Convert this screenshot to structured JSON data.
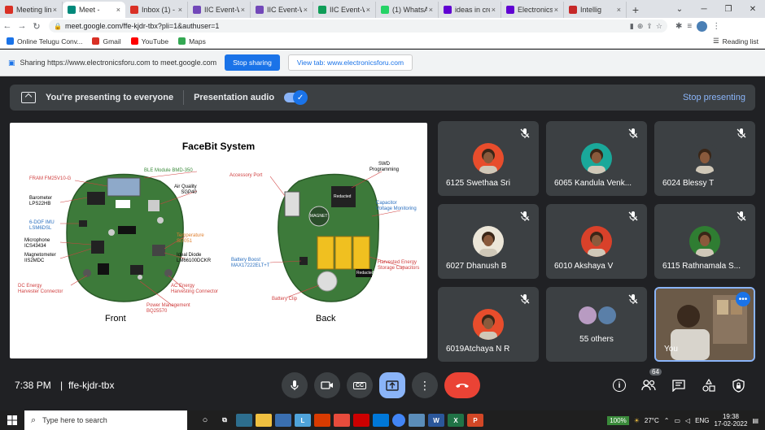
{
  "browser": {
    "tabs": [
      {
        "label": "Meeting lin",
        "icon": "gmail-icon",
        "color": "#d93025"
      },
      {
        "label": "Meet -",
        "icon": "meet-icon",
        "color": "#00897b",
        "active": true
      },
      {
        "label": "Inbox (1) -",
        "icon": "gmail-icon",
        "color": "#d93025"
      },
      {
        "label": "IIC Event-W",
        "icon": "forms-icon",
        "color": "#7248b9"
      },
      {
        "label": "IIC Event-W",
        "icon": "forms-icon",
        "color": "#7248b9"
      },
      {
        "label": "IIC Event-W",
        "icon": "sheets-icon",
        "color": "#0f9d58"
      },
      {
        "label": "(1) WhatsA",
        "icon": "whatsapp-icon",
        "color": "#25d366"
      },
      {
        "label": "ideas in cre",
        "icon": "yahoo-icon",
        "color": "#6001d2"
      },
      {
        "label": "Electronics",
        "icon": "yahoo-icon",
        "color": "#6001d2"
      },
      {
        "label": "Intellig",
        "icon": "ieee-icon",
        "color": "#c62828"
      }
    ],
    "url": "meet.google.com/ffe-kjdr-tbx?pli=1&authuser=1",
    "bookmarks": [
      {
        "label": "Online Telugu Conv...",
        "icon": "shield-icon",
        "color": "#1a73e8"
      },
      {
        "label": "Gmail",
        "icon": "gmail-icon",
        "color": "#d93025"
      },
      {
        "label": "YouTube",
        "icon": "youtube-icon",
        "color": "#ff0000"
      },
      {
        "label": "Maps",
        "icon": "maps-icon",
        "color": "#34a853"
      }
    ],
    "reading_list": "Reading list"
  },
  "sharebar": {
    "text": "Sharing https://www.electronicsforu.com to meet.google.com",
    "stop_label": "Stop sharing",
    "view_label": "View tab: www.electronicsforu.com"
  },
  "presenting": {
    "text": "You're presenting to everyone",
    "audio_label": "Presentation audio",
    "stop_label": "Stop presenting"
  },
  "slide": {
    "title": "FaceBit System",
    "front_label": "Front",
    "back_label": "Back",
    "front_annotations": [
      {
        "text": "FRAM FM25V10-G",
        "color": "red"
      },
      {
        "text": "BLE Module BMD-350",
        "color": "green"
      },
      {
        "text": "Barometer\nLPS22HB",
        "color": "dark"
      },
      {
        "text": "Air Quality\nSGP40",
        "color": "dark"
      },
      {
        "text": "6-DOF IMU\nLSM6DSL",
        "color": "blue"
      },
      {
        "text": "Microphone\nICS43434",
        "color": "dark"
      },
      {
        "text": "Temperature\nSI7051",
        "color": "orange"
      },
      {
        "text": "Magnetometer\nIIS2MDC",
        "color": "dark"
      },
      {
        "text": "Ideal Diode\nLM66100DCKR",
        "color": "dark"
      },
      {
        "text": "DC Energy\nHarvester Connector",
        "color": "red"
      },
      {
        "text": "AC Energy\nHarvesting Connector",
        "color": "red"
      },
      {
        "text": "Power Management\nBQ25570",
        "color": "red"
      }
    ],
    "back_annotations": [
      {
        "text": "Accessory Port",
        "color": "red"
      },
      {
        "text": "SWD\nProgramming",
        "color": "dark"
      },
      {
        "text": "Capacitor\nVoltage Monitoring",
        "color": "blue"
      },
      {
        "text": "Harvested Energy\nStorage Capacitors",
        "color": "red"
      },
      {
        "text": "Battery Boost\nMAX17222ELT+T",
        "color": "blue"
      },
      {
        "text": "Battery Clip",
        "color": "red"
      }
    ],
    "back_board_text": [
      "MAGNET",
      "Redacted",
      "Redacted"
    ]
  },
  "participants": [
    {
      "name": "6125 Swethaa Sri",
      "muted": true,
      "bg": "#e84d2c"
    },
    {
      "name": "6065 Kandula Venk...",
      "muted": true,
      "bg": "#1aa89a"
    },
    {
      "name": "6024 Blessy T",
      "muted": true,
      "bg": "#3c4043"
    },
    {
      "name": "6027 Dhanush B",
      "muted": true,
      "bg": "#ece6d8"
    },
    {
      "name": "6010 Akshaya V",
      "muted": true,
      "bg": "#d9412a"
    },
    {
      "name": "6115 Rathnamala S...",
      "muted": true,
      "bg": "#2f7d32"
    },
    {
      "name": "6019Atchaya N R",
      "muted": true,
      "bg": "#e84d2c"
    },
    {
      "name": "55 others",
      "muted": true,
      "bg": "#3c4043"
    },
    {
      "name": "You",
      "muted": false,
      "bg": "#5a4c3e"
    }
  ],
  "meetbar": {
    "time": "7:38 PM",
    "separator": "|",
    "code": "ffe-kjdr-tbx",
    "people_count": "64"
  },
  "taskbar": {
    "search_placeholder": "Type here to search",
    "battery": "100%",
    "temperature": "27°C",
    "lang": "ENG",
    "time": "19:38",
    "date": "17-02-2022"
  },
  "colors": {
    "accent": "#1a73e8",
    "meet_bg": "#202124",
    "leave": "#ea4335",
    "light_accent": "#8ab4f8"
  }
}
